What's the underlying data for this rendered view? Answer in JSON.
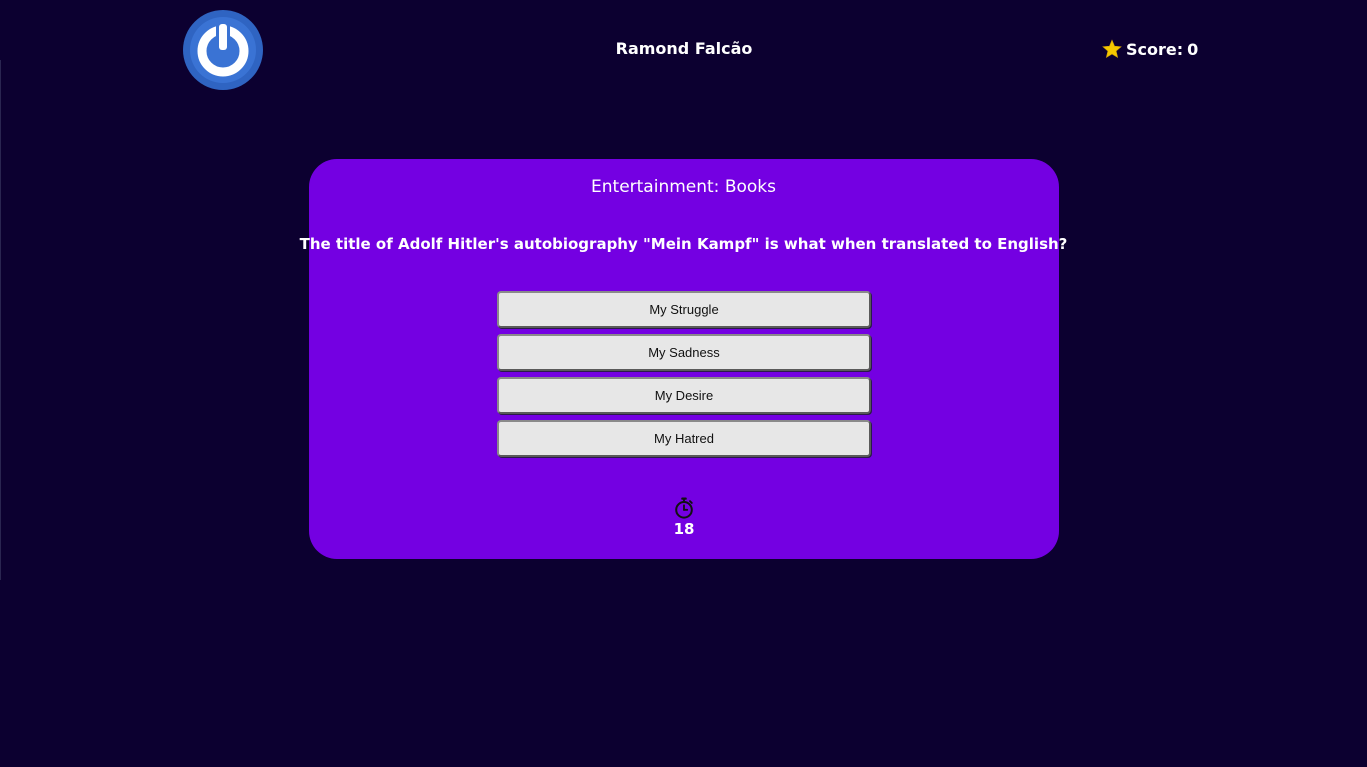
{
  "header": {
    "logo_icon": "power-icon",
    "player_name": "Ramond Falcão",
    "score": {
      "icon": "star-icon",
      "label": "Score:",
      "value": "0"
    }
  },
  "quiz": {
    "category": "Entertainment: Books",
    "question": "The title of Adolf Hitler's autobiography \"Mein Kampf\" is what when translated to English?",
    "answers": [
      {
        "label": "My Struggle"
      },
      {
        "label": "My Sadness"
      },
      {
        "label": "My Desire"
      },
      {
        "label": "My Hatred"
      }
    ],
    "timer": {
      "icon": "stopwatch-icon",
      "value": "18"
    }
  },
  "colors": {
    "background": "#0c0030",
    "card": "#7400e2",
    "answer_button": "#e7e7e7",
    "logo_blue": "#2f64c2",
    "star": "#f5c800"
  }
}
